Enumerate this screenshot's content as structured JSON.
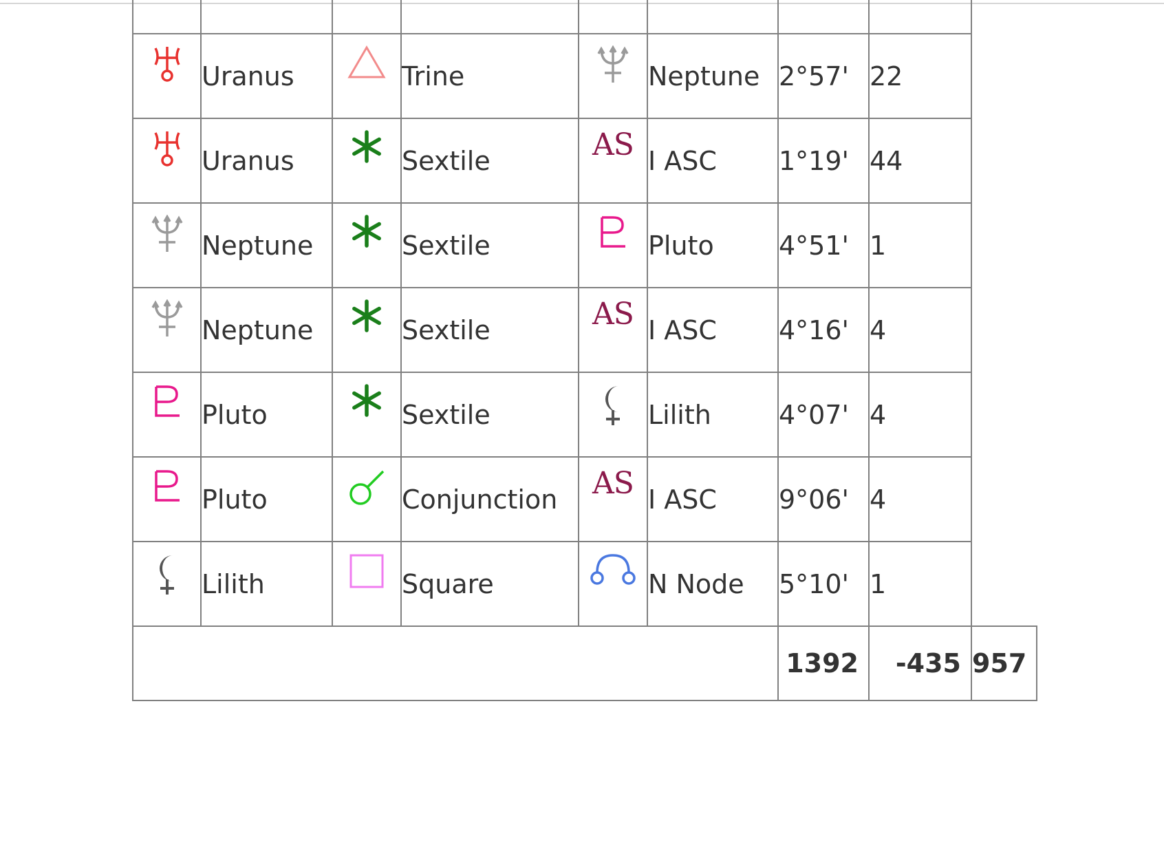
{
  "rows": [
    {
      "planet1": "Uranus",
      "planet1_icon": "uranus-icon",
      "aspect": "Trine",
      "aspect_icon": "trine-icon",
      "planet2": "Neptune",
      "planet2_icon": "neptune-icon",
      "orb": "2°57'",
      "score": "22"
    },
    {
      "planet1": "Uranus",
      "planet1_icon": "uranus-icon",
      "aspect": "Sextile",
      "aspect_icon": "sextile-icon",
      "planet2": "I ASC",
      "planet2_icon": "ascendant-icon",
      "orb": "1°19'",
      "score": "44"
    },
    {
      "planet1": "Neptune",
      "planet1_icon": "neptune-icon",
      "aspect": "Sextile",
      "aspect_icon": "sextile-icon",
      "planet2": "Pluto",
      "planet2_icon": "pluto-icon",
      "orb": "4°51'",
      "score": "1"
    },
    {
      "planet1": "Neptune",
      "planet1_icon": "neptune-icon",
      "aspect": "Sextile",
      "aspect_icon": "sextile-icon",
      "planet2": "I ASC",
      "planet2_icon": "ascendant-icon",
      "orb": "4°16'",
      "score": "4"
    },
    {
      "planet1": "Pluto",
      "planet1_icon": "pluto-icon",
      "aspect": "Sextile",
      "aspect_icon": "sextile-icon",
      "planet2": "Lilith",
      "planet2_icon": "lilith-icon",
      "orb": "4°07'",
      "score": "4"
    },
    {
      "planet1": "Pluto",
      "planet1_icon": "pluto-icon",
      "aspect": "Conjunction",
      "aspect_icon": "conjunction-icon",
      "planet2": "I ASC",
      "planet2_icon": "ascendant-icon",
      "orb": "9°06'",
      "score": "4"
    },
    {
      "planet1": "Lilith",
      "planet1_icon": "lilith-icon",
      "aspect": "Square",
      "aspect_icon": "square-icon",
      "planet2": "N Node",
      "planet2_icon": "north-node-icon",
      "orb": "5°10'",
      "score": "1"
    }
  ],
  "ascendant_glyph": "AS",
  "totals": {
    "col1": "1392",
    "col2": "-435",
    "col3": "957"
  },
  "colors": {
    "uranus": "#e8322f",
    "neptune": "#9a9a9a",
    "pluto": "#e8198c",
    "lilith": "#555555",
    "trine": "#f28b8b",
    "sextile": "#1a7f1a",
    "conjunction": "#22cc22",
    "square": "#f07cf0",
    "north_node": "#4a78e0",
    "ascendant": "#8b1a4b",
    "border": "#808080"
  }
}
